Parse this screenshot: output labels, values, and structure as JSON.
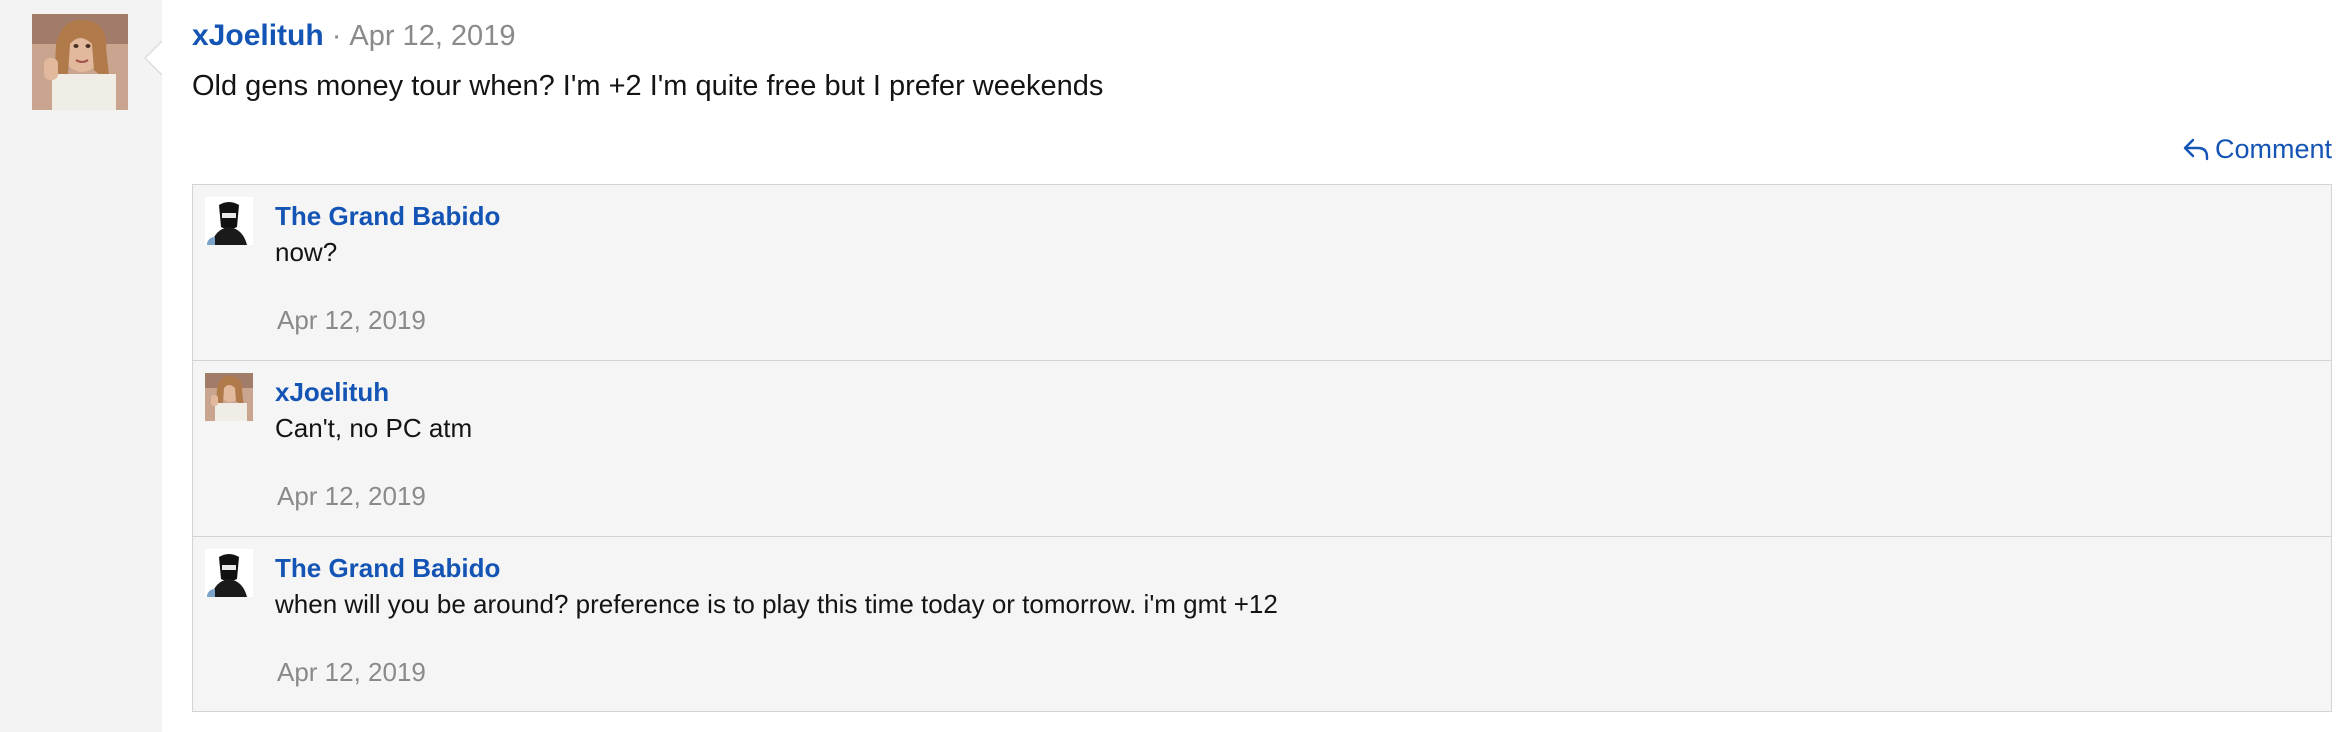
{
  "post": {
    "author": "xJoelituh",
    "separator": "·",
    "date": "Apr 12, 2019",
    "body": "Old gens money tour when? I'm +2 I'm quite free but I prefer weekends",
    "author_avatar_icon": "user-avatar-photo"
  },
  "actions": {
    "comment_label": "Comment",
    "comment_icon": "reply-arrow-icon"
  },
  "comments": [
    {
      "author": "The Grand Babido",
      "text": "now?",
      "date": "Apr 12, 2019",
      "avatar_icon": "masked-figure-avatar"
    },
    {
      "author": "xJoelituh",
      "text": "Can't, no PC atm",
      "date": "Apr 12, 2019",
      "avatar_icon": "user-avatar-photo"
    },
    {
      "author": "The Grand Babido",
      "text": "when will you be around? preference is to play this time today or tomorrow. i'm gmt +12",
      "date": "Apr 12, 2019",
      "avatar_icon": "masked-figure-avatar"
    }
  ],
  "colors": {
    "link_blue": "#1454b4",
    "muted_gray": "#8a8a8a",
    "comments_bg": "#f5f5f5",
    "sidebar_bg": "#f3f3f3"
  }
}
